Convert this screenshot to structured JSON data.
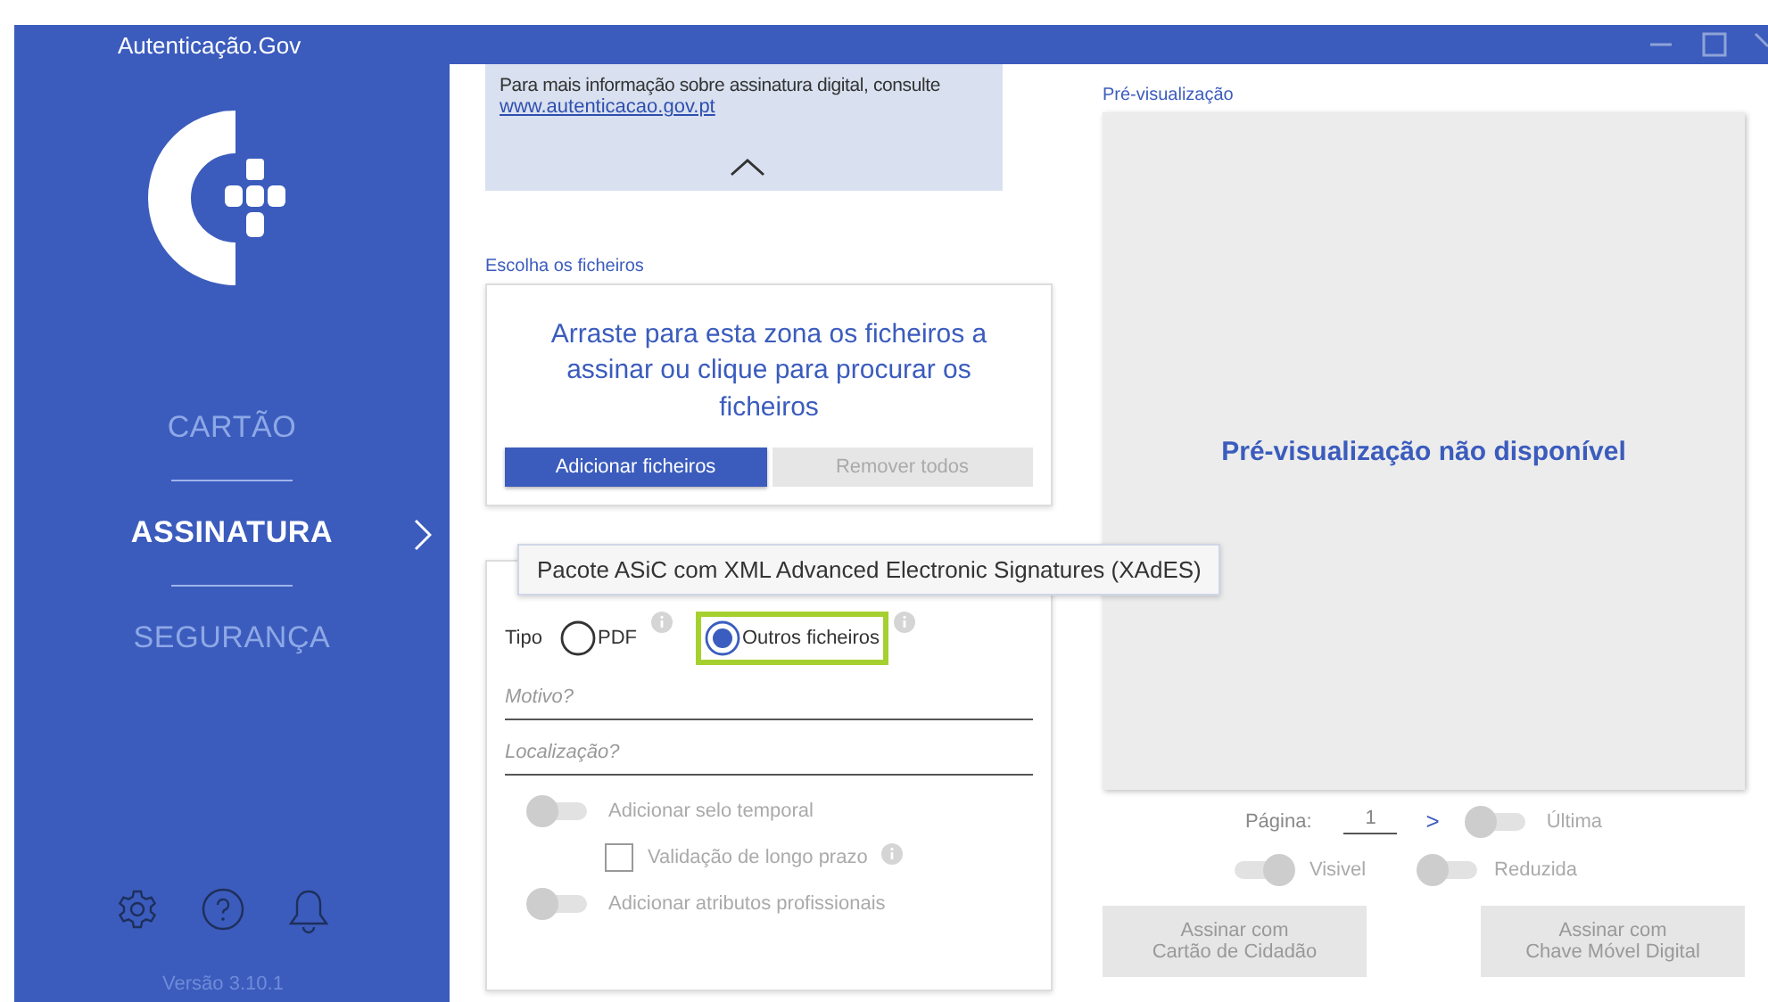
{
  "window": {
    "title": "Autenticação.Gov"
  },
  "sidebar": {
    "items": [
      {
        "label": "CARTÃO",
        "selected": false
      },
      {
        "label": "ASSINATURA",
        "selected": true
      },
      {
        "label": "SEGURANÇA",
        "selected": false
      }
    ],
    "version": "Versão 3.10.1"
  },
  "info": {
    "text": "Para mais informação sobre assinatura digital, consulte",
    "link": "www.autenticacao.gov.pt",
    "expanded": true
  },
  "files": {
    "title": "Escolha os ficheiros",
    "drop_text": "Arraste para esta zona os ficheiros a assinar ou clique para procurar os ficheiros",
    "buttons": [
      {
        "label": "Adicionar ficheiros",
        "disabled": false
      },
      {
        "label": "Remover todos",
        "disabled": true
      }
    ]
  },
  "tooltip": "Pacote ASiC com XML Advanced Electronic Signatures (XAdES)",
  "options": {
    "type_label": "Tipo",
    "types": [
      {
        "label": "PDF",
        "selected": false,
        "highlighted": false
      },
      {
        "label": "Outros ficheiros",
        "selected": true,
        "highlighted": true
      }
    ],
    "fields": [
      {
        "placeholder": "Motivo?"
      },
      {
        "placeholder": "Localização?"
      }
    ],
    "settings": [
      {
        "kind": "toggle",
        "label": "Adicionar selo temporal",
        "on": false,
        "disabled": true
      },
      {
        "kind": "checkbox",
        "label": "Validação de longo prazo",
        "checked": false,
        "disabled": true,
        "info": true
      },
      {
        "kind": "toggle",
        "label": "Adicionar atributos profissionais",
        "on": false,
        "disabled": true
      }
    ]
  },
  "preview": {
    "title": "Pré-visualização",
    "message": "Pré-visualização não disponível",
    "page_label": "Página:",
    "page_value": "1",
    "next": ">",
    "toggles": [
      {
        "label": "Última",
        "on": false
      },
      {
        "label": "Visivel",
        "on": true
      },
      {
        "label": "Reduzida",
        "on": false
      }
    ],
    "buttons": [
      {
        "label": "Assinar com\nCartão de Cidadão",
        "disabled": true
      },
      {
        "label": "Assinar com\nChave Móvel Digital",
        "disabled": true
      }
    ]
  }
}
